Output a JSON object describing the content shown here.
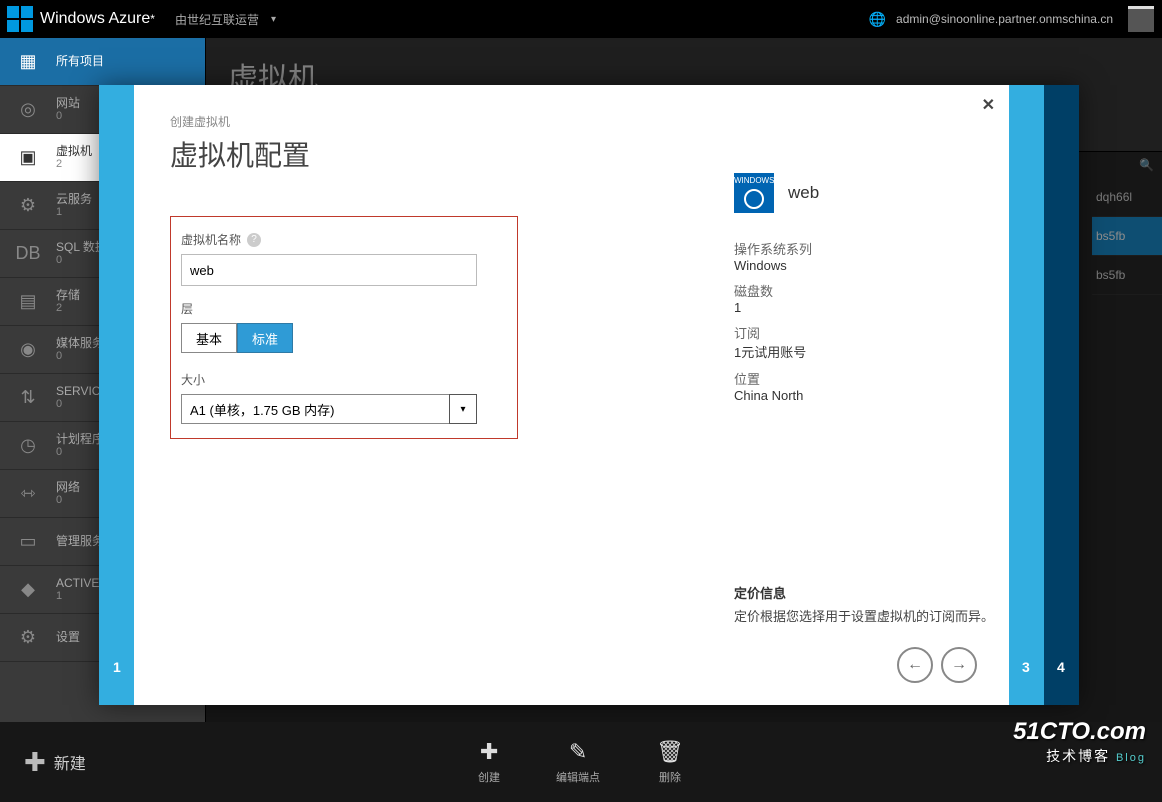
{
  "topbar": {
    "brand": "Windows Azure",
    "brand_suffix": "*",
    "sub": "由世纪互联运营",
    "account": "admin@sinoonline.partner.onmschina.cn"
  },
  "sidebar": [
    {
      "label": "所有项目",
      "count": ""
    },
    {
      "label": "网站",
      "count": "0"
    },
    {
      "label": "虚拟机",
      "count": "2"
    },
    {
      "label": "云服务",
      "count": "1"
    },
    {
      "label": "SQL 数据库",
      "count": "0"
    },
    {
      "label": "存储",
      "count": "2"
    },
    {
      "label": "媒体服务",
      "count": "0"
    },
    {
      "label": "SERVICE BUS",
      "count": "0"
    },
    {
      "label": "计划程序",
      "count": "0"
    },
    {
      "label": "网络",
      "count": "0"
    },
    {
      "label": "管理服务",
      "count": ""
    },
    {
      "label": "ACTIVE DIRECTORY",
      "count": "1"
    },
    {
      "label": "设置",
      "count": ""
    }
  ],
  "page_title": "虚拟机",
  "right_preview": {
    "search": "🔍",
    "rows": [
      "dqh66l",
      "bs5fb",
      "bs5fb"
    ]
  },
  "wizard": {
    "crumb": "创建虚拟机",
    "title": "虚拟机配置",
    "name_label": "虚拟机名称",
    "name_value": "web",
    "tier_label": "层",
    "tier_basic": "基本",
    "tier_standard": "标准",
    "size_label": "大小",
    "size_value": "A1 (单核，1.75 GB 内存)",
    "summary_name": "web",
    "os_k": "操作系统系列",
    "os_v": "Windows",
    "disk_k": "磁盘数",
    "disk_v": "1",
    "sub_k": "订阅",
    "sub_v": "1元试用账号",
    "loc_k": "位置",
    "loc_v": "China North",
    "pricing_t": "定价信息",
    "pricing_d": "定价根据您选择用于设置虚拟机的订阅而异。",
    "step1": "1",
    "step3": "3",
    "step4": "4",
    "thumb": "WINDOWS"
  },
  "bottom": {
    "new": "新建",
    "create": "创建",
    "edit": "编辑端点",
    "delete": "删除"
  },
  "watermark": {
    "a": "51CTO.com",
    "b": "技术博客",
    "c": "Blog"
  }
}
